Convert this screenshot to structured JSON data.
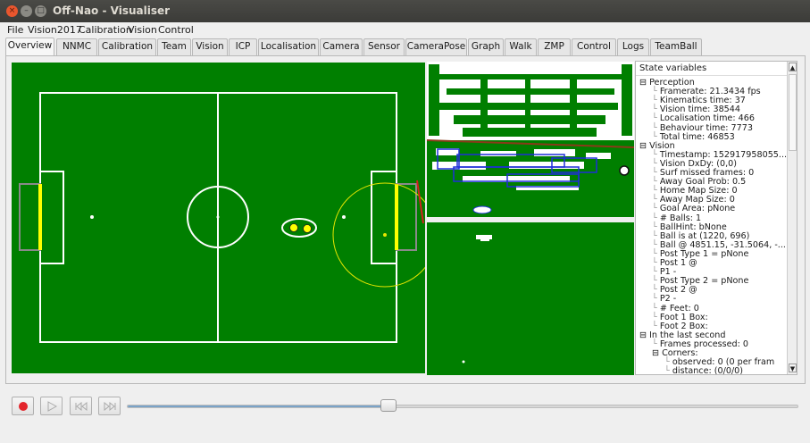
{
  "window": {
    "title": "Off-Nao - Visualiser"
  },
  "menu": [
    "File",
    "Vision2017",
    "Calibration",
    "Vision",
    "Control"
  ],
  "tabs": [
    "Overview",
    "NNMC",
    "Calibration",
    "Team",
    "Vision",
    "ICP",
    "Localisation",
    "Camera",
    "Sensor",
    "CameraPose",
    "Graph",
    "Walk",
    "ZMP",
    "Control",
    "Logs",
    "TeamBall"
  ],
  "active_tab": "Overview",
  "state": {
    "header": "State variables",
    "rows": [
      {
        "text": "Perception",
        "expander": "⊟",
        "level": 0
      },
      {
        "text": "Framerate: 21.3434 fps",
        "level": 1
      },
      {
        "text": "Kinematics time: 37",
        "level": 1
      },
      {
        "text": "Vision time: 38544",
        "level": 1
      },
      {
        "text": "Localisation time: 466",
        "level": 1
      },
      {
        "text": "Behaviour time: 7773",
        "level": 1
      },
      {
        "text": "Total time: 46853",
        "level": 1
      },
      {
        "text": "Vision",
        "expander": "⊟",
        "level": 0
      },
      {
        "text": "Timestamp: 152917958055...",
        "level": 1
      },
      {
        "text": "Vision DxDy: (0,0)",
        "level": 1
      },
      {
        "text": "Surf missed frames: 0",
        "level": 1
      },
      {
        "text": "Away Goal Prob: 0.5",
        "level": 1
      },
      {
        "text": "Home Map Size: 0",
        "level": 1
      },
      {
        "text": "Away Map Size: 0",
        "level": 1
      },
      {
        "text": "Goal Area: pNone",
        "level": 1
      },
      {
        "text": "# Balls: 1",
        "level": 1
      },
      {
        "text": "BallHint: bNone",
        "level": 1
      },
      {
        "text": "Ball is at (1220, 696)",
        "level": 1
      },
      {
        "text": "Ball @ 4851.15, -31.5064, -...",
        "level": 1
      },
      {
        "text": "Post Type 1 = pNone",
        "level": 1
      },
      {
        "text": "Post 1 @",
        "level": 1
      },
      {
        "text": "P1 -",
        "level": 1
      },
      {
        "text": "Post Type 2 = pNone",
        "level": 1
      },
      {
        "text": "Post 2 @",
        "level": 1
      },
      {
        "text": "P2 -",
        "level": 1
      },
      {
        "text": "# Feet: 0",
        "level": 1
      },
      {
        "text": "Foot 1 Box:",
        "level": 1
      },
      {
        "text": "Foot 2 Box:",
        "level": 1
      },
      {
        "text": "In the last second",
        "expander": "⊟",
        "level": 0
      },
      {
        "text": "Frames processed: 0",
        "level": 1
      },
      {
        "text": "Corners:",
        "expander": "⊟",
        "level": 1
      },
      {
        "text": "observed: 0 (0 per fram",
        "level": 2
      },
      {
        "text": "distance: (0/0/0)",
        "level": 2
      }
    ]
  },
  "playback": {
    "record_icon": "record-icon",
    "play_icon": "play-icon",
    "skip_back_icon": "skip-back-icon",
    "skip_forward_icon": "skip-forward-icon",
    "position_fraction": 0.39
  },
  "colors": {
    "field": "#007f00",
    "goal_yellow": "#ffff00",
    "record_red": "#e3242b"
  }
}
